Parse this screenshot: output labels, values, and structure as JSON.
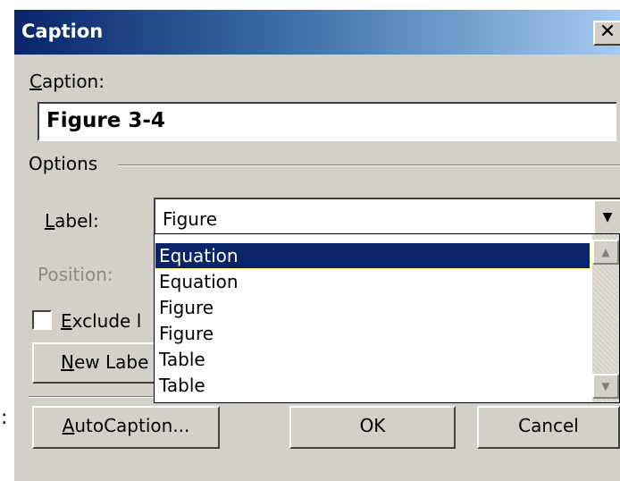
{
  "window": {
    "title": "Caption",
    "close_glyph": "✕"
  },
  "caption": {
    "label": "Caption:",
    "label_accel": "C",
    "label_rest": "aption:",
    "value": "Figure 3-4"
  },
  "options": {
    "title": "Options",
    "label_field": {
      "label_accel": "L",
      "label_rest": "abel:",
      "selected_value": "Figure",
      "dropdown_open": true,
      "items": [
        {
          "text": "Equation",
          "highlighted": true
        },
        {
          "text": "Equation",
          "highlighted": false
        },
        {
          "text": "Figure",
          "highlighted": false
        },
        {
          "text": "Figure",
          "highlighted": false
        },
        {
          "text": "Table",
          "highlighted": false
        },
        {
          "text": "Table",
          "highlighted": false
        }
      ]
    },
    "position_field": {
      "label": "Position:",
      "disabled": true
    },
    "exclude_checkbox": {
      "label_accel": "E",
      "label_rest": "xclude l",
      "checked": false
    },
    "new_label_button": {
      "label_accel": "N",
      "label_rest": "ew Labe"
    }
  },
  "buttons": {
    "autocaption_accel": "A",
    "autocaption_rest": "utoCaption...",
    "ok": "OK",
    "cancel": "Cancel"
  },
  "edge_mark": ":",
  "icons": {
    "dropdown_arrow": "▼",
    "scroll_up": "▲",
    "scroll_down": "▼"
  },
  "colors": {
    "dialog_face": "#d4d0c8",
    "title_gradient_start": "#0a246a",
    "title_gradient_end": "#a6caf0",
    "selection": "#0a246a",
    "disabled_text": "#8c8a84"
  }
}
